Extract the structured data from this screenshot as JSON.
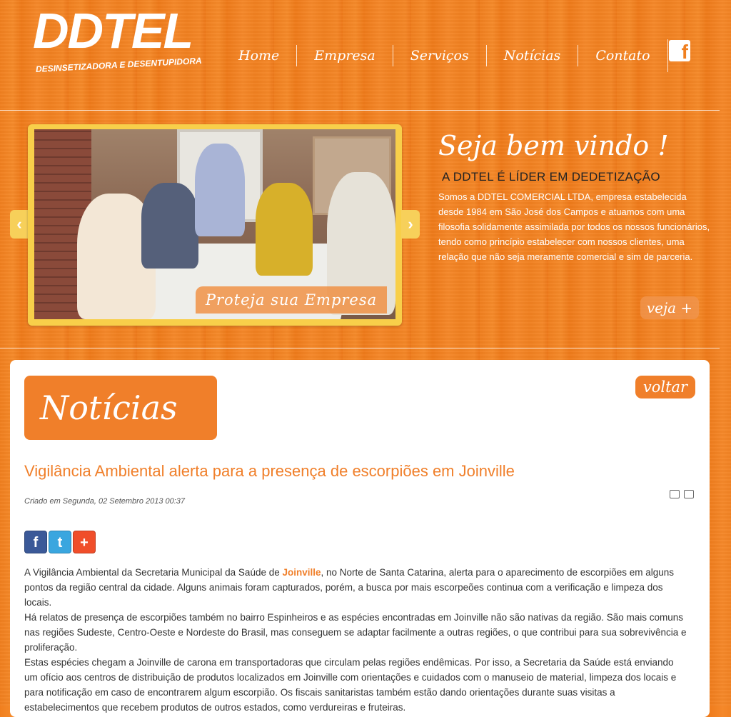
{
  "logo": {
    "title": "DDTEL",
    "subtitle": "DESINSETIZADORA E DESENTUPIDORA"
  },
  "nav": {
    "items": [
      "Home",
      "Empresa",
      "Serviços",
      "Notícias",
      "Contato"
    ]
  },
  "social": {
    "facebook_glyph": "f"
  },
  "slider": {
    "caption": "Proteja sua Empresa",
    "prev": "‹",
    "next": "›"
  },
  "welcome": {
    "title": "Seja bem vindo !",
    "subtitle": "A DDTEL É LÍDER EM DEDETIZAÇÃO",
    "text": "Somos a DDTEL COMERCIAL LTDA, empresa estabelecida desde 1984 em São José dos Campos e atuamos com uma filosofia solidamente assimilada por todos os nossos funcionários, tendo como princípio estabelecer com nossos clientes, uma relação que não seja meramente comercial e sim de parceria.",
    "more": "veja +"
  },
  "content": {
    "section": "Notícias",
    "back": "voltar",
    "title": "Vigilância Ambiental alerta para a presença de escorpiões em Joinville",
    "created": "Criado em Segunda, 02 Setembro 2013 00:37",
    "share": {
      "fb": "f",
      "tw": "t",
      "plus": "+"
    },
    "p1_a": "A Vigilância Ambiental da Secretaria Municipal da Saúde de ",
    "p1_link": "Joinville",
    "p1_b": ", no Norte de Santa Catarina, alerta para o aparecimento de escorpiões em alguns pontos da região central da cidade. Alguns animais foram capturados, porém, a busca por mais escorpeões continua com a verificação e limpeza dos locais.",
    "p2": "Há relatos de presença de escorpiões também no bairro Espinheiros e as espécies encontradas em Joinville não são nativas da região. São mais comuns nas regiões Sudeste, Centro-Oeste e Nordeste do Brasil, mas conseguem se adaptar facilmente a outras regiões, o que contribui para sua sobrevivência e proliferação.",
    "p3": "Estas espécies chegam a Joinville de carona em transportadoras que circulam pelas regiões endêmicas. Por isso, a Secretaria da Saúde está enviando um ofício aos centros de distribuição de produtos localizados em Joinville com orientações e cuidados com o manuseio de material, limpeza dos locais e para notificação em caso de encontrarem algum escorpião. Os fiscais sanitaristas também estão dando orientações durante suas visitas a estabelecimentos que recebem produtos de outros estados, como verdureiras e fruteiras."
  }
}
